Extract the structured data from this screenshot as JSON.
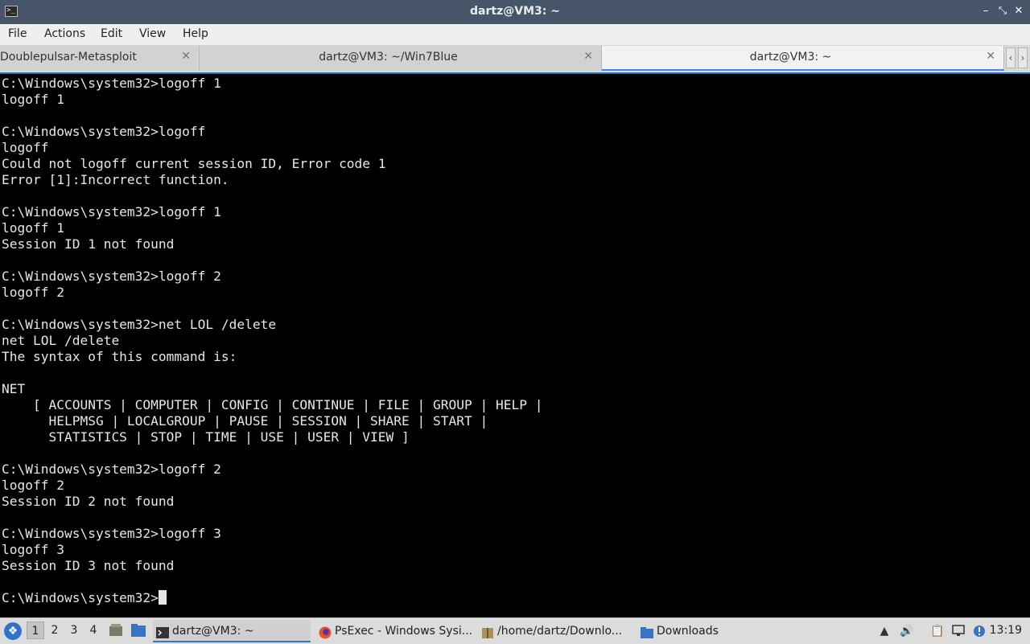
{
  "window": {
    "title": "dartz@VM3: ~",
    "minimize_glyph": "–",
    "maximize_glyph": "⤡",
    "close_glyph": "✕"
  },
  "menu": [
    "File",
    "Actions",
    "Edit",
    "View",
    "Help"
  ],
  "tabs": [
    {
      "label": "Doublepulsar-Metasploit",
      "active": false
    },
    {
      "label": "dartz@VM3: ~/Win7Blue",
      "active": false
    },
    {
      "label": "dartz@VM3: ~",
      "active": true
    }
  ],
  "tab_close_glyph": "✕",
  "terminal": {
    "lines": [
      "C:\\Windows\\system32>logoff 1",
      "logoff 1",
      "",
      "C:\\Windows\\system32>logoff",
      "logoff",
      "Could not logoff current session ID, Error code 1",
      "Error [1]:Incorrect function.",
      "",
      "C:\\Windows\\system32>logoff 1",
      "logoff 1",
      "Session ID 1 not found",
      "",
      "C:\\Windows\\system32>logoff 2",
      "logoff 2",
      "",
      "C:\\Windows\\system32>net LOL /delete",
      "net LOL /delete",
      "The syntax of this command is:",
      "",
      "NET",
      "    [ ACCOUNTS | COMPUTER | CONFIG | CONTINUE | FILE | GROUP | HELP |",
      "      HELPMSG | LOCALGROUP | PAUSE | SESSION | SHARE | START |",
      "      STATISTICS | STOP | TIME | USE | USER | VIEW ]",
      "",
      "C:\\Windows\\system32>logoff 2",
      "logoff 2",
      "Session ID 2 not found",
      "",
      "C:\\Windows\\system32>logoff 3",
      "logoff 3",
      "Session ID 3 not found",
      ""
    ],
    "prompt": "C:\\Windows\\system32>"
  },
  "taskbar": {
    "desktops": [
      "1",
      "2",
      "3",
      "4"
    ],
    "tasks": [
      {
        "label": "dartz@VM3: ~",
        "icon": "terminal-icon",
        "active": true
      },
      {
        "label": "PsExec - Windows Sysi...",
        "icon": "firefox-icon",
        "active": false
      },
      {
        "label": "/home/dartz/Downlo...",
        "icon": "archive-icon",
        "active": false
      },
      {
        "label": "Downloads",
        "icon": "folder-icon",
        "active": false
      }
    ],
    "clock": "13:19"
  },
  "colors": {
    "titlebar": "#465567",
    "accent": "#3b8ede",
    "terminal_bg": "#000000",
    "terminal_fg": "#e6e6e6"
  }
}
